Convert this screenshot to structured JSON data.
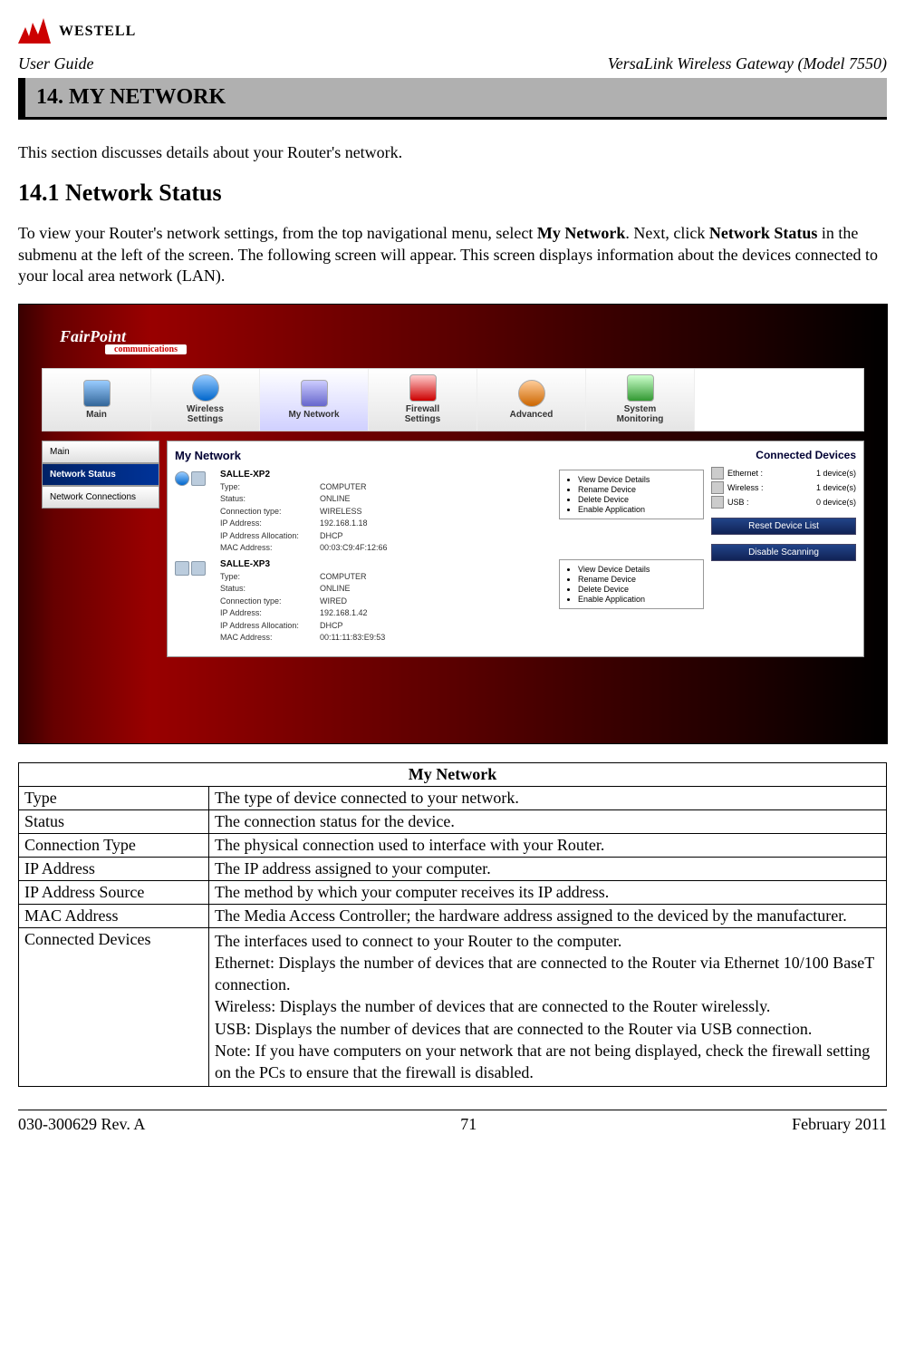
{
  "brand": "WESTELL",
  "header": {
    "left": "User Guide",
    "right": "VersaLink Wireless Gateway (Model 7550)"
  },
  "chapter_title": "14. MY NETWORK",
  "intro": "This section discusses details about your Router's network.",
  "section_heading": "14.1 Network Status",
  "section_para_1": "To view your Router's network settings, from the top navigational menu, select ",
  "section_para_bold1": "My Network",
  "section_para_2": ". Next, click ",
  "section_para_bold2": "Network Status",
  "section_para_3": " in the submenu at the left of the screen. The following screen will appear. This screen displays information about the devices connected to your local area network (LAN).",
  "screenshot": {
    "logo": "FairPoint",
    "logo_sub": "communications",
    "nav": [
      {
        "label_line1": "Main",
        "label_line2": ""
      },
      {
        "label_line1": "Wireless",
        "label_line2": "Settings"
      },
      {
        "label_line1": "My Network",
        "label_line2": ""
      },
      {
        "label_line1": "Firewall",
        "label_line2": "Settings"
      },
      {
        "label_line1": "Advanced",
        "label_line2": ""
      },
      {
        "label_line1": "System",
        "label_line2": "Monitoring"
      }
    ],
    "side_menu": [
      {
        "label": "Main"
      },
      {
        "label": "Network Status",
        "selected": true
      },
      {
        "label": "Network Connections"
      }
    ],
    "panel_title": "My Network",
    "devices": [
      {
        "name": "SALLE-XP2",
        "rows": [
          {
            "k": "Type:",
            "v": "COMPUTER"
          },
          {
            "k": "Status:",
            "v": "ONLINE"
          },
          {
            "k": "Connection type:",
            "v": "WIRELESS"
          },
          {
            "k": "IP Address:",
            "v": "192.168.1.18"
          },
          {
            "k": "IP Address Allocation:",
            "v": "DHCP"
          },
          {
            "k": "MAC Address:",
            "v": "00:03:C9:4F:12:66"
          }
        ]
      },
      {
        "name": "SALLE-XP3",
        "rows": [
          {
            "k": "Type:",
            "v": "COMPUTER"
          },
          {
            "k": "Status:",
            "v": "ONLINE"
          },
          {
            "k": "Connection type:",
            "v": "WIRED"
          },
          {
            "k": "IP Address:",
            "v": "192.168.1.42"
          },
          {
            "k": "IP Address Allocation:",
            "v": "DHCP"
          },
          {
            "k": "MAC Address:",
            "v": "00:11:11:83:E9:53"
          }
        ]
      }
    ],
    "actions": [
      "View Device Details",
      "Rename Device",
      "Delete Device",
      "Enable Application"
    ],
    "connected_title": "Connected Devices",
    "connected": [
      {
        "label": "Ethernet :",
        "count": "1 device(s)"
      },
      {
        "label": "Wireless :",
        "count": "1 device(s)"
      },
      {
        "label": "USB :",
        "count": "0 device(s)"
      }
    ],
    "btn_reset": "Reset Device List",
    "btn_disable": "Disable Scanning"
  },
  "table": {
    "title": "My Network",
    "rows": [
      {
        "field": "Type",
        "desc": "The type of device connected to your network."
      },
      {
        "field": "Status",
        "desc": "The connection status for the device."
      },
      {
        "field": "Connection Type",
        "desc": "The physical connection used to interface with your Router."
      },
      {
        "field": "IP Address",
        "desc": "The IP address assigned to your computer."
      },
      {
        "field": "IP Address Source",
        "desc": "The method by which your computer receives its IP address."
      },
      {
        "field": "MAC Address",
        "desc": "The Media Access Controller; the hardware address assigned to the deviced by the manufacturer."
      },
      {
        "field": "Connected Devices",
        "desc": "The interfaces used to connect to your Router to the computer.\nEthernet: Displays the number of devices that are connected to the Router via Ethernet 10/100 BaseT connection.\nWireless: Displays the number of devices that are connected to the Router wirelessly.\nUSB: Displays the number of devices that are connected to the Router via USB connection.\nNote: If you have computers on your network that are not being displayed, check the firewall setting on the PCs to ensure that the firewall is disabled."
      }
    ]
  },
  "footer": {
    "left": "030-300629 Rev. A",
    "center": "71",
    "right": "February 2011"
  }
}
